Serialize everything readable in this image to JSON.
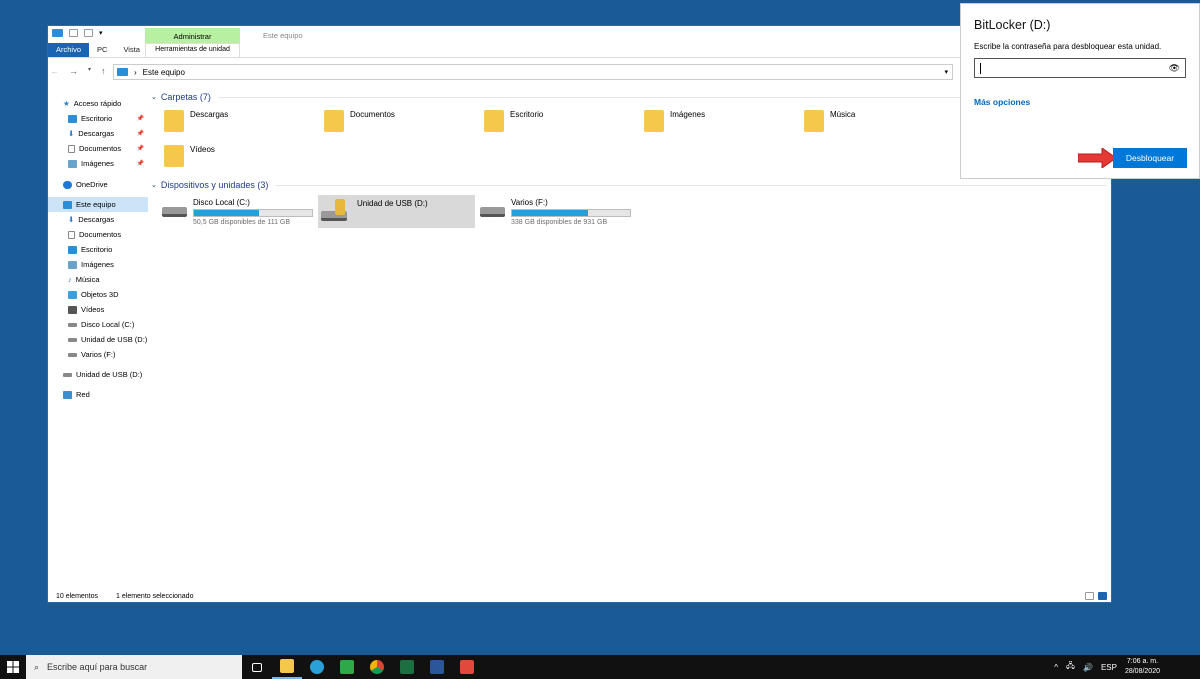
{
  "explorer": {
    "ribbon": {
      "file_tab": "Archivo",
      "tabs": [
        "PC",
        "Vista"
      ],
      "context_group": "Administrar",
      "context_tab": "Herramientas de unidad",
      "window_title": "Este equipo"
    },
    "address": {
      "path": "Este equipo"
    },
    "nav": {
      "quick_access": "Acceso rápido",
      "quick_items": [
        "Escritorio",
        "Descargas",
        "Documentos",
        "Imágenes"
      ],
      "onedrive": "OneDrive",
      "this_pc": "Este equipo",
      "pc_items": [
        "Descargas",
        "Documentos",
        "Escritorio",
        "Imágenes",
        "Música",
        "Objetos 3D",
        "Vídeos",
        "Disco Local (C:)",
        "Unidad de USB (D:)",
        "Varios (F:)"
      ],
      "usb": "Unidad de USB (D:)",
      "network": "Red"
    },
    "folders": {
      "header": "Carpetas (7)",
      "items": [
        "Descargas",
        "Documentos",
        "Escritorio",
        "Imágenes",
        "Música",
        "Vídeos"
      ]
    },
    "drives": {
      "header": "Dispositivos y unidades (3)",
      "items": [
        {
          "name": "Disco Local (C:)",
          "free": "50,5 GB disponibles de 111 GB",
          "used_fraction": 0.55
        },
        {
          "name": "Unidad de USB (D:)",
          "locked": true
        },
        {
          "name": "Varios (F:)",
          "free": "338 GB disponibles de 931 GB",
          "used_fraction": 0.64
        }
      ]
    },
    "status": {
      "count": "10 elementos",
      "selected": "1 elemento seleccionado"
    }
  },
  "bitlocker": {
    "title": "BitLocker (D:)",
    "prompt": "Escribe la contraseña para desbloquear esta unidad.",
    "password": "",
    "more_options": "Más opciones",
    "unlock": "Desbloquear"
  },
  "taskbar": {
    "search_placeholder": "Escribe aquí para buscar",
    "lang": "ESP",
    "time": "7:06 a. m.",
    "date": "28/08/2020"
  }
}
